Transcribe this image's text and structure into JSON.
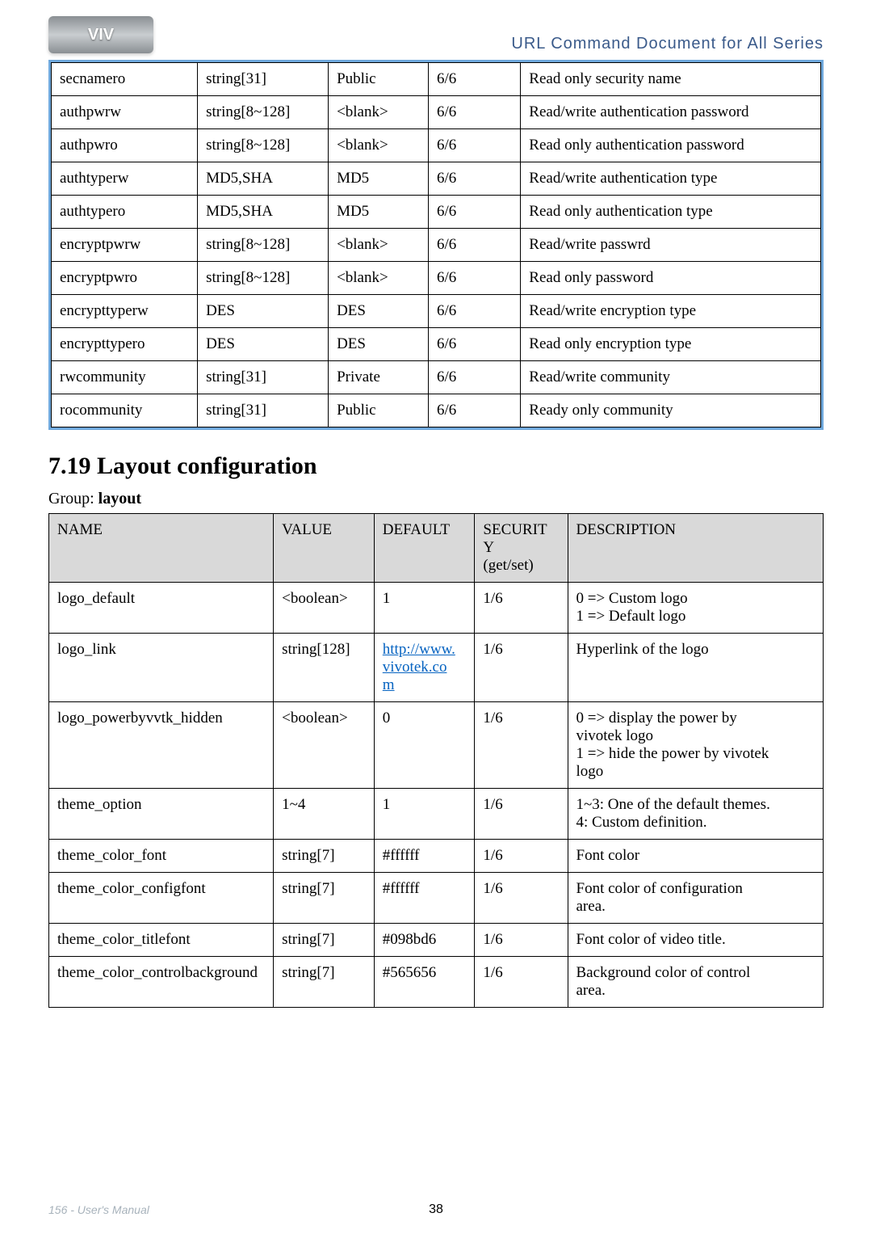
{
  "header": {
    "logo_text": "VIV",
    "doc_title": "URL Command Document for All Series"
  },
  "table1": {
    "rows": [
      {
        "name": "secnamero",
        "value": "string[31]",
        "def": "Public",
        "sec": "6/6",
        "desc": "Read only security name"
      },
      {
        "name": "authpwrw",
        "value": "string[8~128]",
        "def": "<blank>",
        "sec": "6/6",
        "desc": "Read/write authentication password"
      },
      {
        "name": "authpwro",
        "value": "string[8~128]",
        "def": "<blank>",
        "sec": "6/6",
        "desc": "Read only authentication password"
      },
      {
        "name": "authtyperw",
        "value": "MD5,SHA",
        "def": "MD5",
        "sec": "6/6",
        "desc": "Read/write authentication type"
      },
      {
        "name": "authtypero",
        "value": "MD5,SHA",
        "def": "MD5",
        "sec": "6/6",
        "desc": "Read only authentication type"
      },
      {
        "name": "encryptpwrw",
        "value": "string[8~128]",
        "def": "<blank>",
        "sec": "6/6",
        "desc": "Read/write passwrd"
      },
      {
        "name": "encryptpwro",
        "value": "string[8~128]",
        "def": "<blank>",
        "sec": "6/6",
        "desc": "Read only password"
      },
      {
        "name": "encrypttyperw",
        "value": "DES",
        "def": "DES",
        "sec": "6/6",
        "desc": "Read/write encryption type"
      },
      {
        "name": "encrypttypero",
        "value": "DES",
        "def": "DES",
        "sec": "6/6",
        "desc": "Read only encryption type"
      },
      {
        "name": "rwcommunity",
        "value": "string[31]",
        "def": "Private",
        "sec": "6/6",
        "desc": "Read/write community"
      },
      {
        "name": "rocommunity",
        "value": "string[31]",
        "def": "Public",
        "sec": "6/6",
        "desc": "Ready only community"
      }
    ]
  },
  "section": {
    "heading": "7.19 Layout configuration",
    "group_prefix": "Group: ",
    "group_name": "layout"
  },
  "table2": {
    "headers": {
      "c1": "NAME",
      "c2": "VALUE",
      "c3": "DEFAULT",
      "c4_l1": "SECURIT",
      "c4_l2": "Y",
      "c4_l3": "(get/set)",
      "c5": "DESCRIPTION"
    },
    "rows": [
      {
        "name": "logo_default",
        "value": "<boolean>",
        "def": "1",
        "sec": "1/6",
        "desc_l1": "0 => Custom logo",
        "desc_l2": "1 => Default logo"
      },
      {
        "name": "logo_link",
        "value": "string[128]",
        "def_l1": "http://www.",
        "def_l2": "vivotek.co",
        "def_l3": "m",
        "sec": "1/6",
        "desc": "Hyperlink of the logo"
      },
      {
        "name": "logo_powerbyvvtk_hidden",
        "value": "<boolean>",
        "def": "0",
        "sec": "1/6",
        "desc_l1": "0 => display the power by",
        "desc_l2": "vivotek logo",
        "desc_l3": "1 => hide the power by vivotek",
        "desc_l4": "logo"
      },
      {
        "name": "theme_option",
        "value": "1~4",
        "def": "1",
        "sec": "1/6",
        "desc_l1": "1~3: One of the default themes.",
        "desc_l2": "4: Custom definition."
      },
      {
        "name": "theme_color_font",
        "value": "string[7]",
        "def": "#ffffff",
        "sec": "1/6",
        "desc": "Font color"
      },
      {
        "name": "theme_color_configfont",
        "value": "string[7]",
        "def": "#ffffff",
        "sec": "1/6",
        "desc_l1": "Font color of configuration",
        "desc_l2": "area."
      },
      {
        "name": "theme_color_titlefont",
        "value": "string[7]",
        "def": "#098bd6",
        "sec": "1/6",
        "desc": "Font color of video title."
      },
      {
        "name": "theme_color_controlbackground",
        "value": "string[7]",
        "def": "#565656",
        "sec": "1/6",
        "desc_l1": "Background color of control",
        "desc_l2": "area."
      }
    ]
  },
  "footer": {
    "left": "156 - User's Manual",
    "center": "38"
  }
}
